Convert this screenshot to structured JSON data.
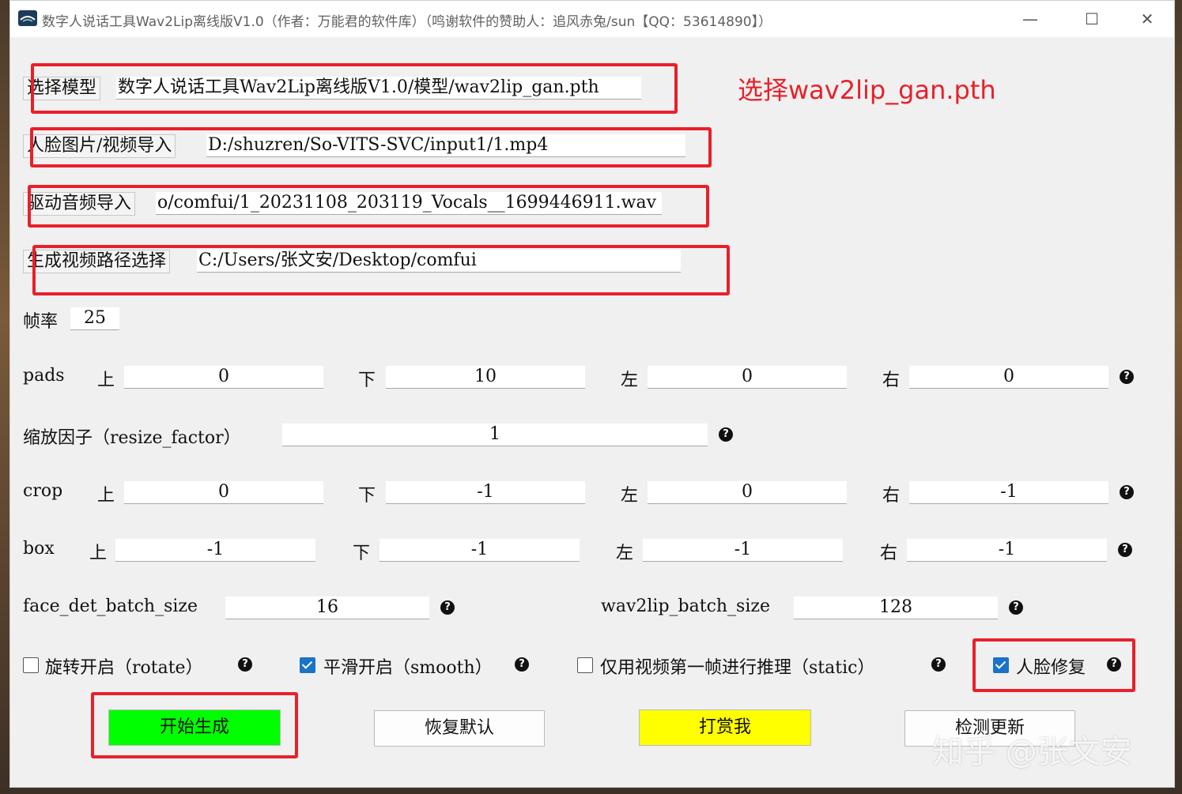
{
  "window": {
    "title": "数字人说话工具Wav2Lip离线版V1.0（作者：万能君的软件库）（鸣谢软件的赞助人：追风赤兔/sun【QQ：53614890】）",
    "minimize_glyph": "—",
    "maximize_glyph": "☐",
    "close_glyph": "✕"
  },
  "files": {
    "model_btn": "选择模型",
    "model_path": "数字人说话工具Wav2Lip离线版V1.0/模型/wav2lip_gan.pth",
    "face_btn": "人脸图片/视频导入",
    "face_path": "D:/shuzren/So-VITS-SVC/input1/1.mp4",
    "audio_btn": "驱动音频导入",
    "audio_path": "o/comfui/1_20231108_203119_Vocals__1699446911.wav",
    "output_btn": "生成视频路径选择",
    "output_path": "C:/Users/张文安/Desktop/comfui"
  },
  "annotation": "选择wav2lip_gan.pth",
  "fps": {
    "label": "帧率",
    "value": "25"
  },
  "pads": {
    "label": "pads",
    "top": "0",
    "bottom": "10",
    "left": "0",
    "right": "0"
  },
  "resize": {
    "label": "缩放因子（resize_factor）",
    "value": "1"
  },
  "crop": {
    "label": "crop",
    "top": "0",
    "bottom": "-1",
    "left": "0",
    "right": "-1"
  },
  "box": {
    "label": "box",
    "top": "-1",
    "bottom": "-1",
    "left": "-1",
    "right": "-1"
  },
  "dir_labels": {
    "top": "上",
    "bottom": "下",
    "left": "左",
    "right": "右"
  },
  "batch": {
    "face_label": "face_det_batch_size",
    "face_value": "16",
    "wav_label": "wav2lip_batch_size",
    "wav_value": "128"
  },
  "options": {
    "rotate": "旋转开启（rotate）",
    "smooth": "平滑开启（smooth）",
    "static": "仅用视频第一帧进行推理（static）",
    "face_restore": "人脸修复"
  },
  "actions": {
    "start": "开始生成",
    "reset": "恢复默认",
    "donate": "打赏我",
    "update": "检测更新"
  },
  "help_glyph": "?",
  "watermark": "知乎 @张文安",
  "colors": {
    "start_bg": "#00ff00",
    "donate_bg": "#ffff00",
    "annotation": "#e8202a",
    "checkbox": "#1a73c8"
  }
}
